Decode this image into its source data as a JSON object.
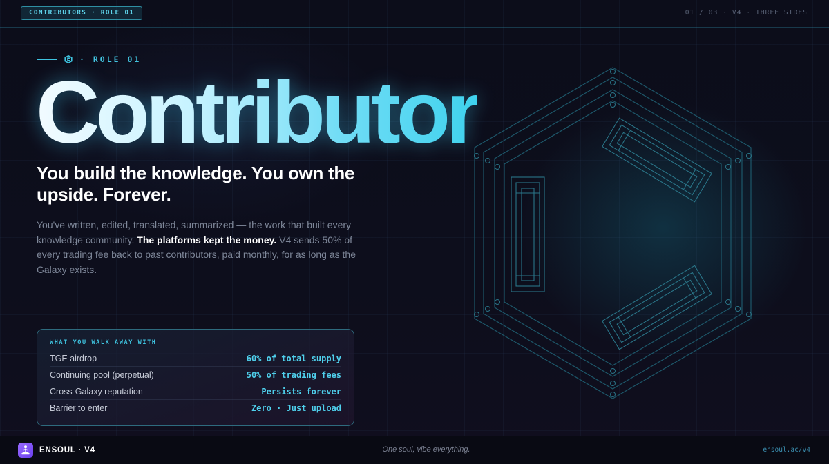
{
  "header": {
    "badge": "CONTRIBUTORS · ROLE 01",
    "meta": "01 / 03 · V4 · THREE SIDES"
  },
  "hero": {
    "eyebrow": "· ROLE 01",
    "title": "Contributor",
    "subtitle": "You build the knowledge. You own the upside. Forever.",
    "description": {
      "before": "You've written, edited, translated, summarized — the work that built every knowledge community.",
      "emphasis": "The platforms kept the money.",
      "after": "V4 sends 50% of every trading fee back to past contributors, paid monthly, for as long as the Galaxy exists."
    }
  },
  "benefits": {
    "heading": "WHAT YOU WALK AWAY WITH",
    "rows": [
      {
        "label": "TGE airdrop",
        "value": "60% of total supply"
      },
      {
        "label": "Continuing pool (perpetual)",
        "value": "50% of trading fees"
      },
      {
        "label": "Cross-Galaxy reputation",
        "value": "Persists forever"
      },
      {
        "label": "Barrier to enter",
        "value": "Zero · Just upload"
      }
    ]
  },
  "footer": {
    "brand": "ENSOUL · V4",
    "tagline": "One soul, vibe everything.",
    "url": "ensoul.ac/v4"
  },
  "colors": {
    "accent": "#3fc4e0",
    "background": "#0b0c17",
    "brand": "#7c4dff"
  },
  "icons": {
    "eyebrow": "hexagon-logo-icon",
    "brand": "meditation-figure-icon",
    "decoration": "hexagon-logo-icon"
  }
}
